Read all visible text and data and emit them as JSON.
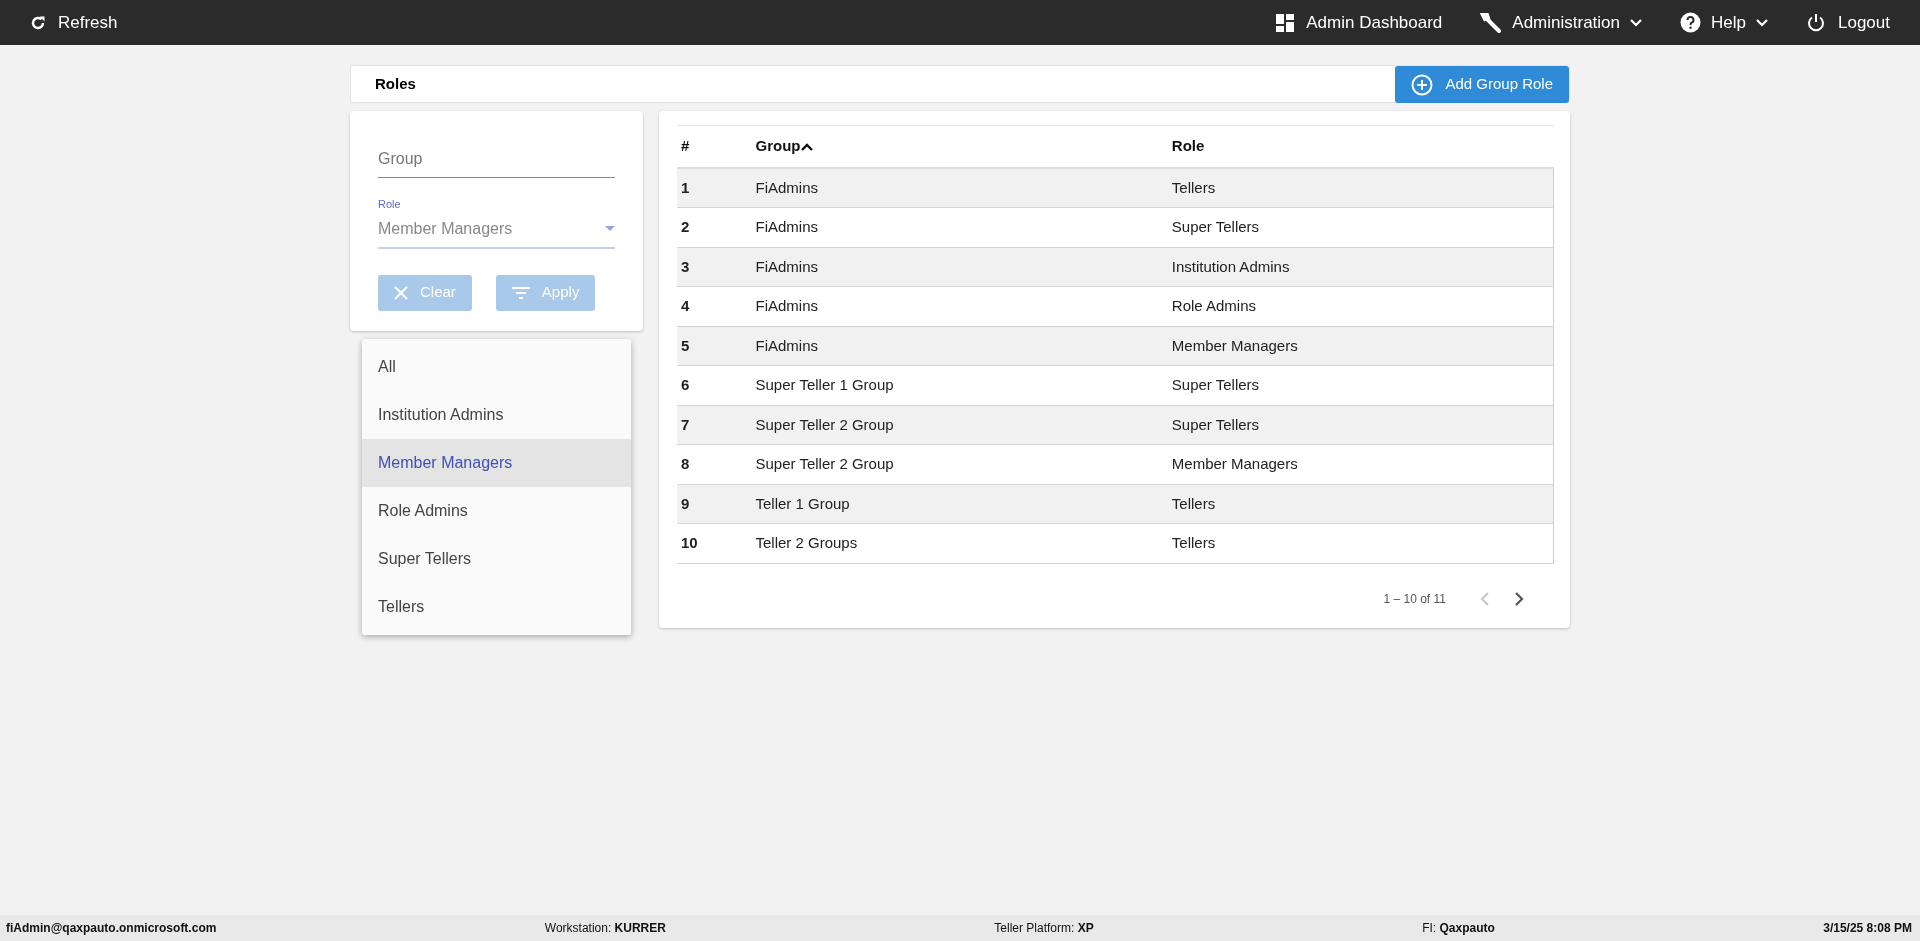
{
  "topbar": {
    "left": [
      {
        "label": "Refresh",
        "has_menu": false
      }
    ],
    "right": [
      {
        "label": "Admin Dashboard",
        "has_menu": false
      },
      {
        "label": "Administration",
        "has_menu": true
      },
      {
        "label": "Help",
        "has_menu": true
      },
      {
        "label": "Logout",
        "has_menu": false
      }
    ]
  },
  "page_title": "Roles",
  "add_button": "Add Group Role",
  "filters": {
    "group": {
      "placeholder": "Group"
    },
    "role": {
      "label": "Role",
      "value": "Member Managers",
      "expanded": true,
      "options": [
        {
          "label": "All",
          "selected": false
        },
        {
          "label": "Institution Admins",
          "selected": false
        },
        {
          "label": "Member Managers",
          "selected": true
        },
        {
          "label": "Role Admins",
          "selected": false
        },
        {
          "label": "Super Tellers",
          "selected": false
        },
        {
          "label": "Tellers",
          "selected": false
        }
      ]
    },
    "buttons": [
      {
        "label": "Clear",
        "kind": "clear"
      },
      {
        "label": "Apply",
        "kind": "apply"
      }
    ]
  },
  "table": {
    "columns": [
      {
        "label": "#",
        "sorted": false
      },
      {
        "label": "Group",
        "sorted": true
      },
      {
        "label": "Role",
        "sorted": false
      }
    ],
    "rows": [
      [
        "1",
        "FiAdmins",
        "Tellers"
      ],
      [
        "2",
        "FiAdmins",
        "Super Tellers"
      ],
      [
        "3",
        "FiAdmins",
        "Institution Admins"
      ],
      [
        "4",
        "FiAdmins",
        "Role Admins"
      ],
      [
        "5",
        "FiAdmins",
        "Member Managers"
      ],
      [
        "6",
        "Super Teller 1 Group",
        "Super Tellers"
      ],
      [
        "7",
        "Super Teller 2 Group",
        "Super Tellers"
      ],
      [
        "8",
        "Super Teller 2 Group",
        "Member Managers"
      ],
      [
        "9",
        "Teller 1 Group",
        "Tellers"
      ],
      [
        "10",
        "Teller 2 Groups",
        "Tellers"
      ]
    ]
  },
  "pager": {
    "range": "1 – 10 of 11",
    "prev": {
      "disabled": true
    },
    "next": {
      "disabled": false
    }
  },
  "status_bar": [
    "**fiAdmin@qaxpauto.onmicrosoft.com**",
    "Workstation: **KURRER**",
    "Teller Platform: **XP**",
    "FI: **Qaxpauto**",
    "**3/15/25 8:08 PM**"
  ]
}
